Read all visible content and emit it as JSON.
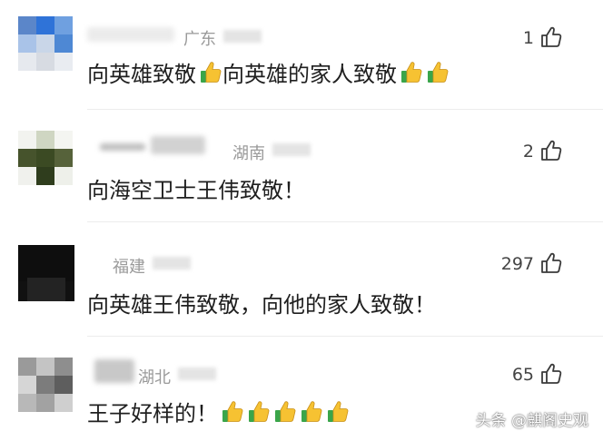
{
  "comments": [
    {
      "location": "广东",
      "likes": "1",
      "text": "向英雄致敬",
      "text2": "向英雄的家人致敬"
    },
    {
      "location": "湖南",
      "likes": "2",
      "text": "向海空卫士王伟致敬！"
    },
    {
      "location": "福建",
      "likes": "297",
      "text": "向英雄王伟致敬，向他的家人致敬！"
    },
    {
      "location": "湖北",
      "likes": "65",
      "text": "王子好样的！"
    }
  ],
  "icons": {
    "like": "thumbs-up-outline-icon",
    "emoji": "thumbs-up-emoji-icon"
  },
  "colors": {
    "emoji_thumb": "#f6c232",
    "emoji_cuff": "#3aa54a",
    "meta": "#9a9a9a"
  },
  "watermark": "头条 @麒阁史观"
}
